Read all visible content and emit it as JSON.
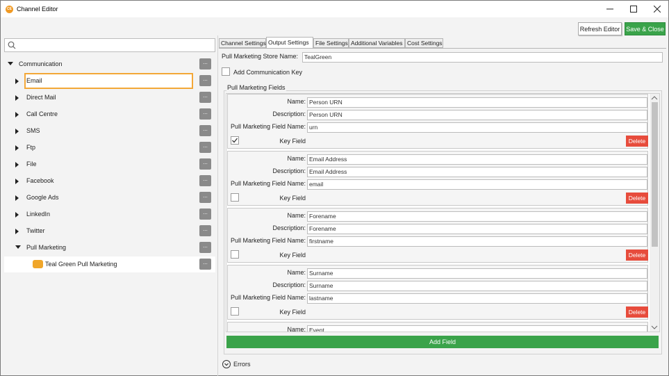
{
  "window": {
    "title": "Channel Editor",
    "icon_text": "CE"
  },
  "toolbar": {
    "refresh_label": "Refresh Editor",
    "save_label": "Save & Close"
  },
  "search": {
    "placeholder": ""
  },
  "tree": {
    "root": {
      "label": "Communication",
      "ellipsis": "..."
    },
    "items": [
      {
        "label": "Email",
        "ellipsis": "..."
      },
      {
        "label": "Direct Mail",
        "ellipsis": "..."
      },
      {
        "label": "Call Centre",
        "ellipsis": "..."
      },
      {
        "label": "SMS",
        "ellipsis": "..."
      },
      {
        "label": "Ftp",
        "ellipsis": "..."
      },
      {
        "label": "File",
        "ellipsis": "..."
      },
      {
        "label": "Facebook",
        "ellipsis": "..."
      },
      {
        "label": "Google Ads",
        "ellipsis": "..."
      },
      {
        "label": "LinkedIn",
        "ellipsis": "..."
      },
      {
        "label": "Twitter",
        "ellipsis": "..."
      },
      {
        "label": "Pull Marketing",
        "ellipsis": "..."
      }
    ],
    "child": {
      "label": "Teal Green Pull Marketing",
      "ellipsis": "..."
    }
  },
  "tabs": [
    "Channel Settings",
    "Output Settings",
    "File Settings",
    "Additional Variables",
    "Cost Settings"
  ],
  "output": {
    "store_name_label": "Pull Marketing Store Name:",
    "store_name_value": "TealGreen",
    "add_comm_key_label": "Add Communication Key",
    "fields_group_label": "Pull Marketing Fields",
    "name_label": "Name:",
    "desc_label": "Description:",
    "pmfield_label": "Pull Marketing Field Name:",
    "key_field_label": "Key Field",
    "delete_label": "Delete",
    "fields": [
      {
        "name": "Person URN",
        "description": "Person URN",
        "pm_name": "urn",
        "key": true
      },
      {
        "name": "Email Address",
        "description": "Email Address",
        "pm_name": "email",
        "key": false
      },
      {
        "name": "Forename",
        "description": "Forename",
        "pm_name": "firstname",
        "key": false
      },
      {
        "name": "Surname",
        "description": "Surname",
        "pm_name": "lastname",
        "key": false
      },
      {
        "name": "Event",
        "description": "",
        "pm_name": "",
        "key": false
      }
    ],
    "add_field_label": "Add Field"
  },
  "errors": {
    "label": "Errors"
  },
  "colors": {
    "accent_orange": "#f3a737",
    "green": "#3aa34a",
    "delete_red": "#e74c3c"
  }
}
